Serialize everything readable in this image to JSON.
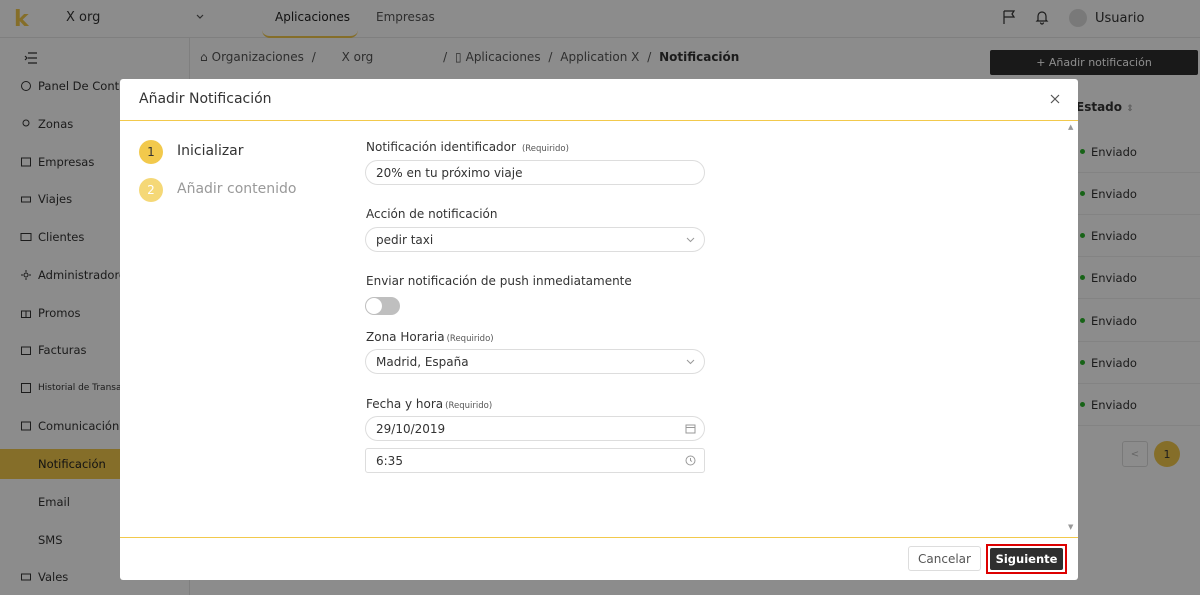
{
  "topbar": {
    "logo": "k",
    "org": "X org",
    "tabs": [
      "Aplicaciones",
      "Empresas"
    ],
    "user": "Usuario"
  },
  "sidebar": {
    "items": [
      {
        "label": "Panel De Control",
        "icon": "dashboard-icon"
      },
      {
        "label": "Zonas",
        "icon": "location-icon"
      },
      {
        "label": "Empresas",
        "icon": "building-icon"
      },
      {
        "label": "Viajes",
        "icon": "car-icon"
      },
      {
        "label": "Clientes",
        "icon": "id-card-icon"
      },
      {
        "label": "Administradores",
        "icon": "admin-icon"
      },
      {
        "label": "Promos",
        "icon": "gift-icon"
      },
      {
        "label": "Facturas",
        "icon": "invoice-icon"
      },
      {
        "label": "Historial de Transacciones",
        "icon": "history-icon"
      },
      {
        "label": "Comunicación",
        "icon": "message-icon"
      },
      {
        "label": "Notificación",
        "icon": ""
      },
      {
        "label": "Email",
        "icon": ""
      },
      {
        "label": "SMS",
        "icon": ""
      },
      {
        "label": "Vales",
        "icon": "voucher-icon"
      }
    ]
  },
  "breadcrumb": {
    "items": [
      "Organizaciones",
      "/",
      "X org",
      "/",
      "Aplicaciones",
      "/",
      "Application X",
      "/"
    ],
    "current": "Notificación"
  },
  "page": {
    "add_button": "+ Añadir notificación",
    "table_header": "Estado",
    "status_rows": [
      "Enviado",
      "Enviado",
      "Enviado",
      "Enviado",
      "Enviado",
      "Enviado",
      "Enviado"
    ],
    "page_number": "1",
    "prev_arrow": "<"
  },
  "modal": {
    "title": "Añadir Notificación",
    "steps": [
      {
        "num": "1",
        "label": "Inicializar"
      },
      {
        "num": "2",
        "label": "Añadir contenido"
      }
    ],
    "fields": {
      "id_label": "Notificación identificador",
      "id_required": "(Requirido)",
      "id_value": "20% en tu próximo viaje",
      "action_label": "Acción de notificación",
      "action_value": "pedir taxi",
      "push_label": "Enviar notificación de push inmediatamente",
      "push_enabled": false,
      "tz_label": "Zona Horaria",
      "tz_required": "(Requirido)",
      "tz_value": "Madrid, España",
      "dt_label": "Fecha y hora",
      "dt_required": "(Requirido)",
      "date_value": "29/10/2019",
      "time_value": "6:35"
    },
    "cancel": "Cancelar",
    "next": "Siguiente"
  }
}
